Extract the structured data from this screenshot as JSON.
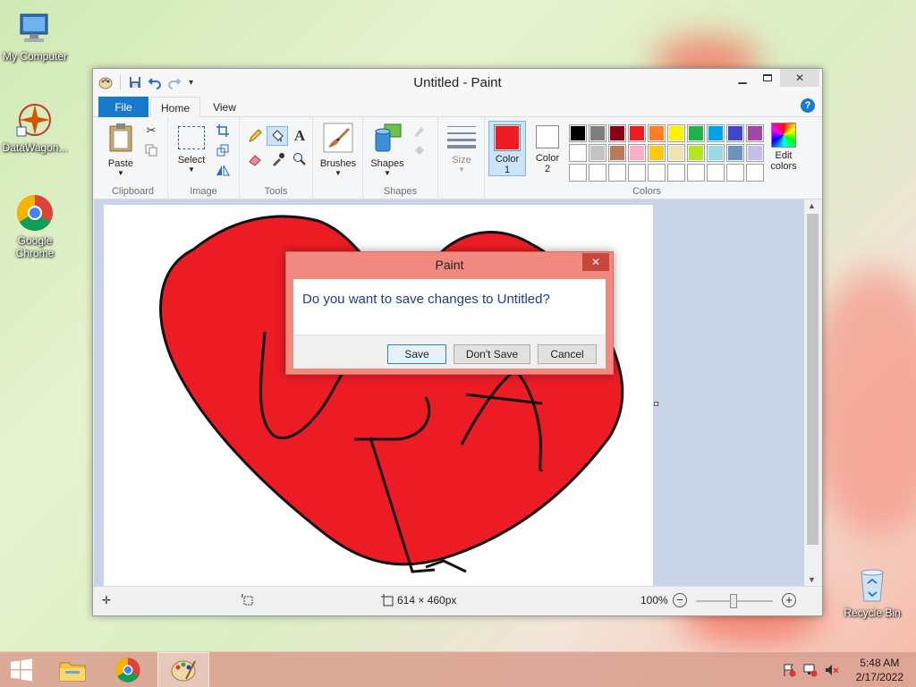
{
  "desktop": {
    "icons": [
      {
        "label": "My Computer"
      },
      {
        "label": "DataWagon..."
      },
      {
        "label": "Google Chrome"
      },
      {
        "label": "Recycle Bin"
      }
    ]
  },
  "window": {
    "title": "Untitled - Paint",
    "tabs": {
      "file": "File",
      "home": "Home",
      "view": "View"
    },
    "help": "?"
  },
  "ribbon": {
    "clipboard": {
      "label": "Clipboard",
      "paste": "Paste"
    },
    "image": {
      "label": "Image",
      "select": "Select"
    },
    "tools": {
      "label": "Tools",
      "text_glyph": "A"
    },
    "brushes": {
      "label": "Brushes"
    },
    "shapes": {
      "label": "Shapes",
      "shapes_button": "Shapes"
    },
    "size": {
      "label": "Size"
    },
    "colors": {
      "label": "Colors",
      "color1": "Color 1",
      "color1_line2": "1",
      "color1_text": "Color",
      "color2_text": "Color",
      "color2_line2": "2",
      "edit": "Edit",
      "edit_line2": "colors",
      "color1_value": "#ed1c24",
      "color2_value": "#ffffff",
      "palette_row1": [
        "#000000",
        "#7f7f7f",
        "#880015",
        "#ed1c24",
        "#ff7f27",
        "#fff200",
        "#22b14c",
        "#00a2e8",
        "#3f48cc",
        "#a349a4"
      ],
      "palette_row2": [
        "#ffffff",
        "#c3c3c3",
        "#b97a57",
        "#ffaec9",
        "#ffc90e",
        "#efe4b0",
        "#b5e61d",
        "#99d9ea",
        "#7092be",
        "#c8bfe7"
      ],
      "palette_row3": [
        "#ffffff",
        "#ffffff",
        "#ffffff",
        "#ffffff",
        "#ffffff",
        "#ffffff",
        "#ffffff",
        "#ffffff",
        "#ffffff",
        "#ffffff"
      ]
    }
  },
  "status": {
    "dimensions": "614 × 460px",
    "zoom": "100%"
  },
  "dialog": {
    "title": "Paint",
    "message": "Do you want to save changes to Untitled?",
    "save": "Save",
    "dont_save": "Don't Save",
    "cancel": "Cancel"
  },
  "taskbar": {
    "time": "5:48 AM",
    "date": "2/17/2022"
  }
}
